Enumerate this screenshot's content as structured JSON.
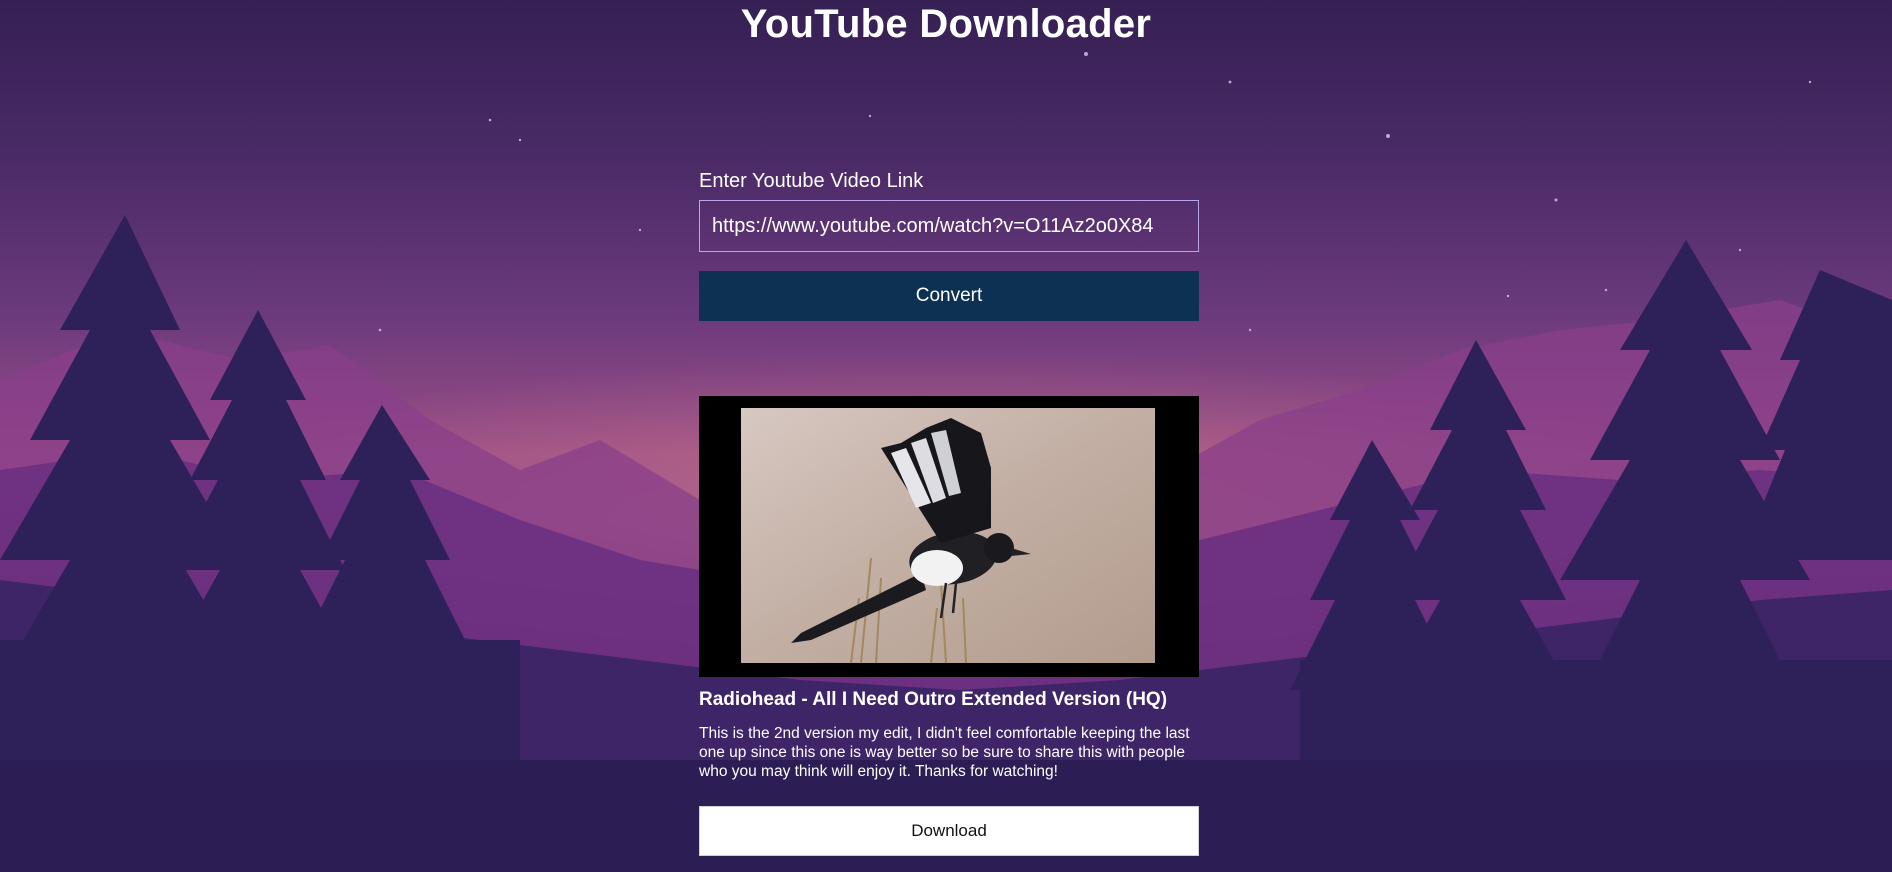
{
  "app": {
    "title": "YouTube Downloader"
  },
  "form": {
    "label": "Enter Youtube Video Link",
    "url_value": "https://www.youtube.com/watch?v=O11Az2o0X84",
    "convert_label": "Convert"
  },
  "video": {
    "title": "Radiohead - All I Need Outro Extended Version (HQ)",
    "description": "This is the 2nd version my edit, I didn't feel comfortable keeping the last one up since this one is way better so be sure to share this with people who you may think will enjoy it. Thanks for watching!",
    "thumbnail_subject": "magpie-in-flight"
  },
  "actions": {
    "download_label": "Download"
  },
  "colors": {
    "convert_button": "#0c3152",
    "download_button": "#ffffff",
    "input_border": "#b9a6e6"
  }
}
